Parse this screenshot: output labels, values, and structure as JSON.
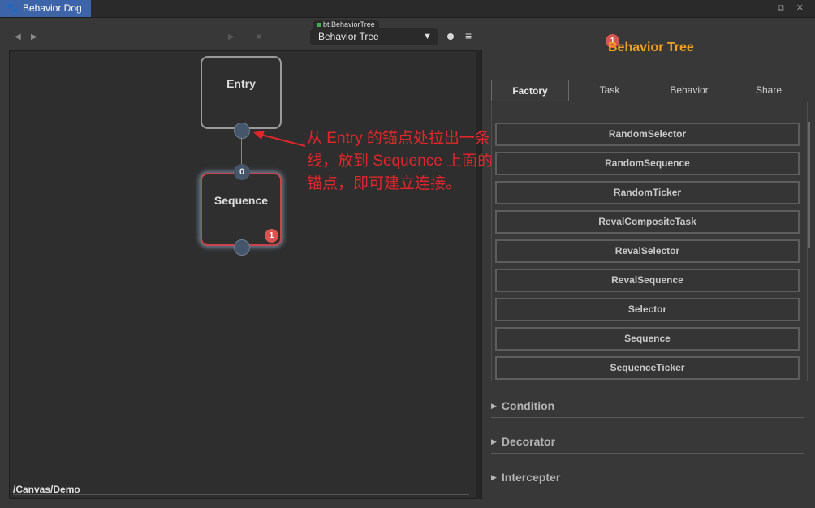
{
  "window": {
    "tab_label": "Behavior Dog",
    "tab_icon": "paw-icon",
    "controls": "⧉ ✕"
  },
  "toolbar": {
    "back": "◀",
    "forward": "▶",
    "play": "▶",
    "stop": "■",
    "tree_chip": "bt.BehaviorTree",
    "tree_select": "Behavior Tree",
    "menu": "≡"
  },
  "canvas": {
    "entry_label": "Entry",
    "sequence_label": "Sequence",
    "sequence_in_index": "0",
    "sequence_badge": "1",
    "path": "/Canvas/Demo",
    "annotation": "从 Entry 的锚点处拉出一条线，放到 Sequence 上面的锚点，即可建立连接。"
  },
  "panel": {
    "badge": "1",
    "title": "Behavior Tree",
    "tabs": [
      "Factory",
      "Task",
      "Behavior",
      "Share"
    ],
    "active_tab": "Factory",
    "factory_items": [
      "RandomSelector",
      "RandomSequence",
      "RandomTicker",
      "RevalCompositeTask",
      "RevalSelector",
      "RevalSequence",
      "Selector",
      "Sequence",
      "SequenceTicker"
    ],
    "sections": [
      "Condition",
      "Decorator",
      "Intercepter"
    ]
  },
  "colors": {
    "accent_tab": "#3d64a8",
    "title_orange": "#f0a020",
    "annotation_red": "#e0262b",
    "badge_red": "#d9534f",
    "sequence_border": "#c8454b"
  }
}
